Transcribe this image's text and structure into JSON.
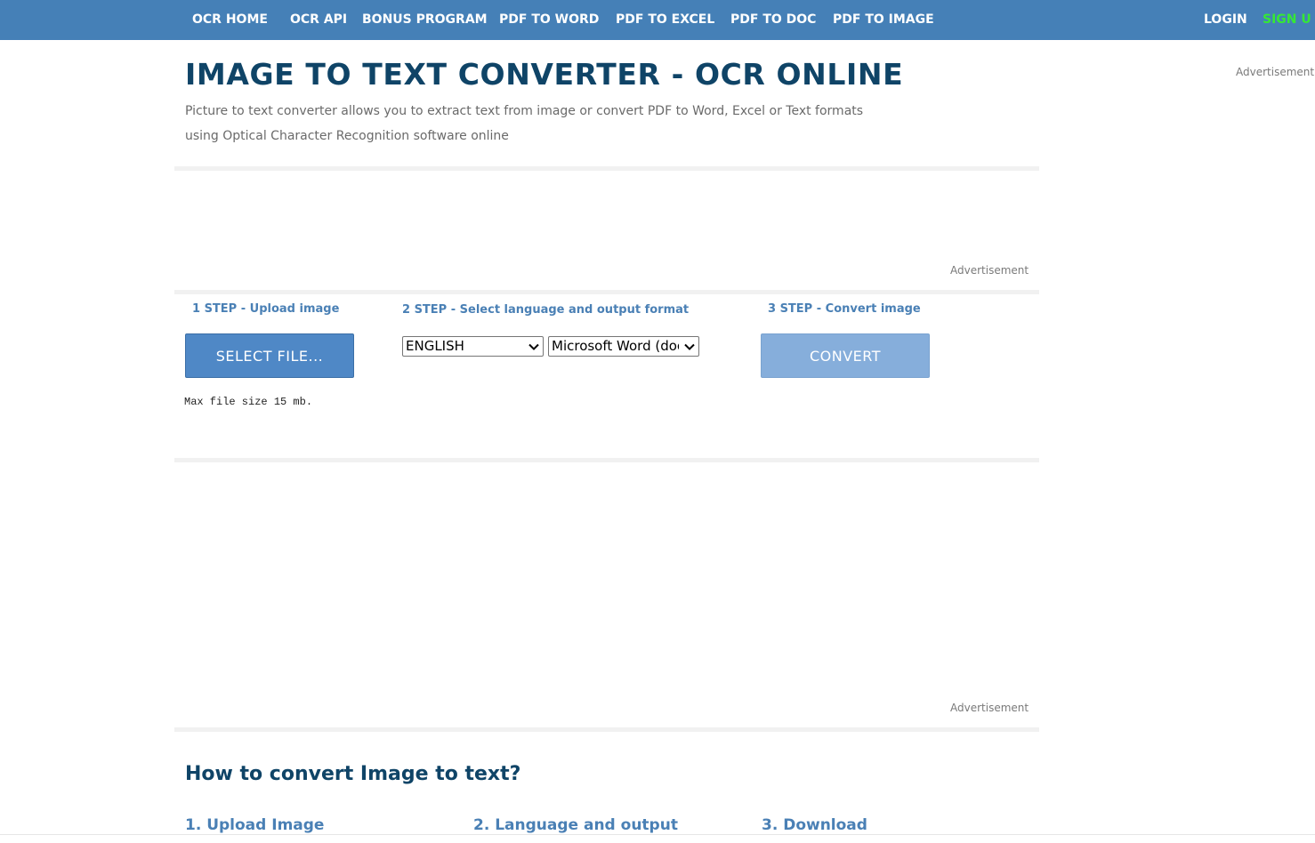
{
  "nav": {
    "items": [
      {
        "label": "OCR HOME"
      },
      {
        "label": "OCR API"
      },
      {
        "label": "BONUS PROGRAM"
      },
      {
        "label": "PDF TO WORD"
      },
      {
        "label": "PDF TO EXCEL"
      },
      {
        "label": "PDF TO DOC"
      },
      {
        "label": "PDF TO IMAGE"
      }
    ],
    "login": "LOGIN",
    "signup": "SIGN U"
  },
  "header": {
    "title": "IMAGE TO TEXT CONVERTER - OCR ONLINE",
    "description": "Picture to text converter allows you to extract text from image or convert PDF to Word, Excel or Text formats using Optical Character Recognition software online"
  },
  "ads": {
    "label": "Advertisement"
  },
  "steps": {
    "step1": {
      "label": "1 STEP - Upload image",
      "button": "SELECT FILE...",
      "note": "Max file size 15 mb."
    },
    "step2": {
      "label": "2 STEP - Select language and output format",
      "language": "ENGLISH",
      "format": "Microsoft Word (docx)"
    },
    "step3": {
      "label": "3 STEP - Convert image",
      "button": "CONVERT"
    }
  },
  "how": {
    "title": "How to convert Image to text?",
    "steps": [
      {
        "label": "1. Upload Image"
      },
      {
        "label": "2. Language and output"
      },
      {
        "label": "3. Download"
      }
    ]
  },
  "colors": {
    "nav_bg": "#4580b7",
    "signup": "#35e835",
    "title": "#0f4467",
    "accent": "#4a80b5",
    "select_button": "#4f88c6",
    "convert_button": "#86aedb"
  }
}
